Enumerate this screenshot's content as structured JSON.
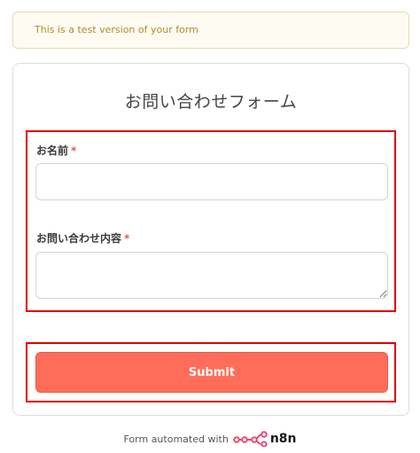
{
  "banner": {
    "text": "This is a test version of your form"
  },
  "form": {
    "title": "お問い合わせフォーム",
    "fields": [
      {
        "label": "お名前",
        "required_mark": "*",
        "value": ""
      },
      {
        "label": "お問い合わせ内容",
        "required_mark": "*",
        "value": ""
      }
    ],
    "submit_label": "Submit"
  },
  "footer": {
    "text": "Form automated with",
    "logo_icon": "n8n-logo-icon",
    "brand": "n8n"
  },
  "colors": {
    "accent": "#ff6d5a",
    "highlight_border": "#e00000",
    "required": "#e05a5a",
    "banner_text": "#b38a2c",
    "brand_icon": "#ea4b71"
  }
}
